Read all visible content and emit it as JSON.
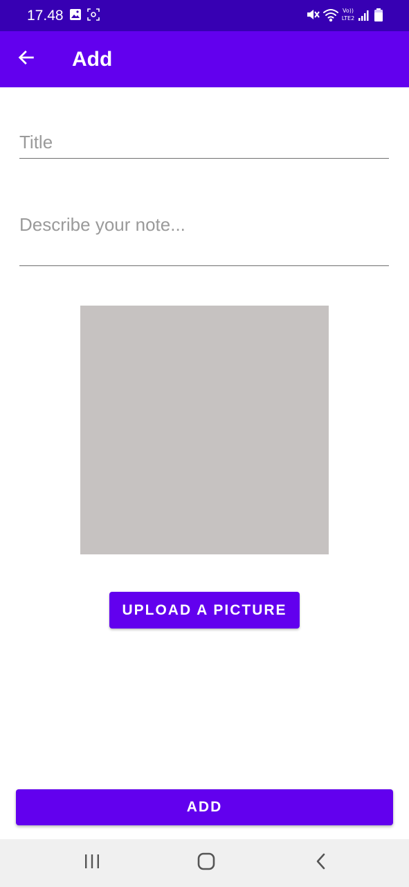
{
  "status_bar": {
    "time": "17.48",
    "network_label": "Vo))\nLTE2",
    "icons": [
      "gallery-icon",
      "screen-record-icon",
      "mute-icon",
      "wifi-icon",
      "volte-icon",
      "signal-icon",
      "battery-icon"
    ]
  },
  "app_bar": {
    "title": "Add",
    "back_icon": "arrow-back-icon"
  },
  "form": {
    "title_placeholder": "Title",
    "title_value": "",
    "description_placeholder": "Describe your note...",
    "description_value": ""
  },
  "upload_button_label": "UPLOAD A PICTURE",
  "add_button_label": "ADD",
  "nav_bar": {
    "icons": [
      "recents-icon",
      "home-icon",
      "back-icon"
    ]
  },
  "colors": {
    "status_bar": "#3700b3",
    "primary": "#6200ee",
    "image_placeholder": "#c6c2c1",
    "nav_bar": "#f0f0f0"
  }
}
